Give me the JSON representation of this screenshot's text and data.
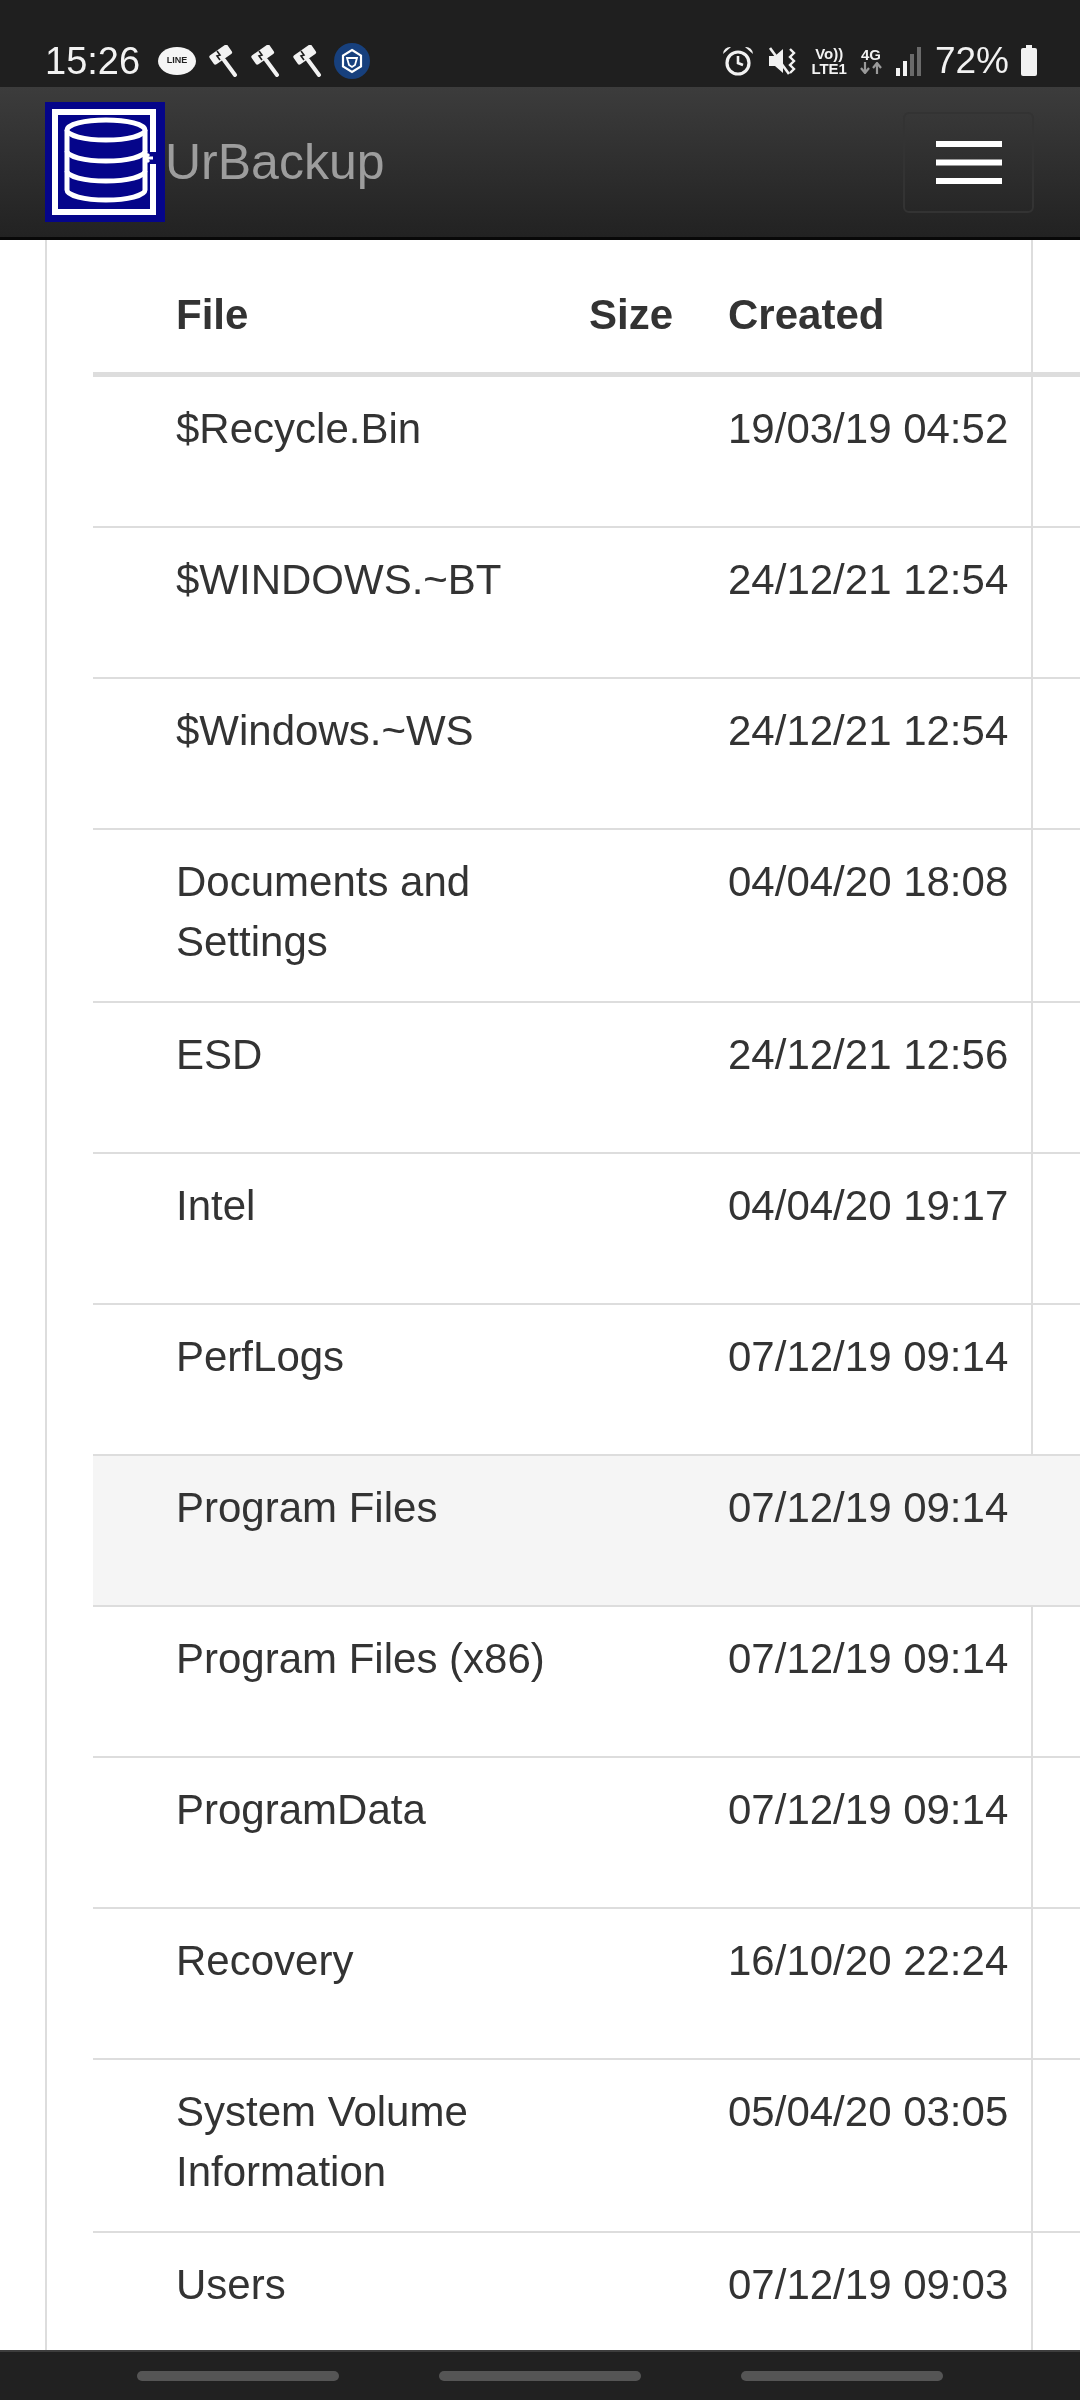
{
  "status_bar": {
    "time": "15:26",
    "notifications": [
      {
        "kind": "chat",
        "label": "LINE"
      },
      {
        "kind": "hammer"
      },
      {
        "kind": "hammer"
      },
      {
        "kind": "hammer"
      },
      {
        "kind": "hexagon"
      }
    ],
    "indicators": [
      {
        "kind": "alarm"
      },
      {
        "kind": "mute"
      },
      {
        "kind": "volte",
        "top": "Vo))",
        "bottom": "LTE1"
      },
      {
        "kind": "data",
        "label": "4G"
      },
      {
        "kind": "signal"
      }
    ],
    "battery": "72%"
  },
  "navbar": {
    "brand": "UrBackup"
  },
  "table": {
    "columns": [
      "File",
      "Size",
      "Created"
    ],
    "rows": [
      {
        "file": "$Recycle.Bin",
        "created": "19/03/19 04:52",
        "selected": false
      },
      {
        "file": "$WINDOWS.~BT",
        "created": "24/12/21 12:54",
        "selected": false
      },
      {
        "file": "$Windows.~WS",
        "created": "24/12/21 12:54",
        "selected": false
      },
      {
        "file": "Documents and Settings",
        "created": "04/04/20 18:08",
        "selected": false
      },
      {
        "file": "ESD",
        "created": "24/12/21 12:56",
        "selected": false
      },
      {
        "file": "Intel",
        "created": "04/04/20 19:17",
        "selected": false
      },
      {
        "file": "PerfLogs",
        "created": "07/12/19 09:14",
        "selected": false
      },
      {
        "file": "Program Files",
        "created": "07/12/19 09:14",
        "selected": true
      },
      {
        "file": "Program Files (x86)",
        "created": "07/12/19 09:14",
        "selected": false
      },
      {
        "file": "ProgramData",
        "created": "07/12/19 09:14",
        "selected": false
      },
      {
        "file": "Recovery",
        "created": "16/10/20 22:24",
        "selected": false
      },
      {
        "file": "System Volume Information",
        "created": "05/04/20 03:05",
        "selected": false
      },
      {
        "file": "Users",
        "created": "07/12/19 09:03",
        "selected": false
      }
    ]
  }
}
